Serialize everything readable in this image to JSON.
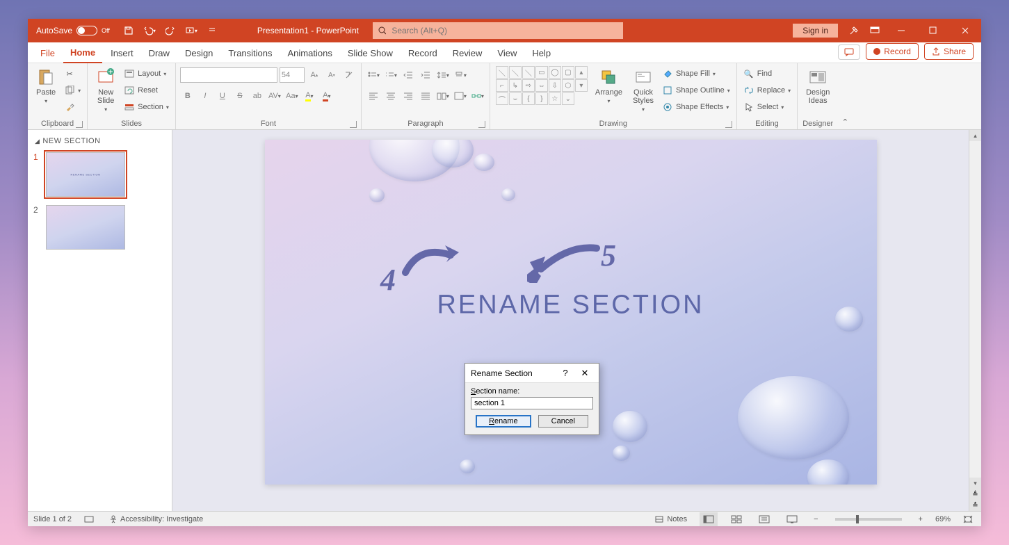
{
  "titlebar": {
    "autosave_label": "AutoSave",
    "autosave_state": "Off",
    "doc_title": "Presentation1 - PowerPoint",
    "search_placeholder": "Search (Alt+Q)",
    "signin": "Sign in"
  },
  "tabs": {
    "file": "File",
    "home": "Home",
    "insert": "Insert",
    "draw": "Draw",
    "design": "Design",
    "transitions": "Transitions",
    "animations": "Animations",
    "slideshow": "Slide Show",
    "record": "Record",
    "review": "Review",
    "view": "View",
    "help": "Help",
    "record_btn": "Record",
    "share_btn": "Share"
  },
  "ribbon": {
    "clipboard": {
      "paste": "Paste",
      "label": "Clipboard"
    },
    "slides": {
      "new_slide": "New\nSlide",
      "layout": "Layout",
      "reset": "Reset",
      "section": "Section",
      "label": "Slides"
    },
    "font": {
      "size": "54",
      "label": "Font"
    },
    "paragraph": {
      "label": "Paragraph"
    },
    "drawing": {
      "arrange": "Arrange",
      "quick_styles": "Quick\nStyles",
      "shape_fill": "Shape Fill",
      "shape_outline": "Shape Outline",
      "shape_effects": "Shape Effects",
      "label": "Drawing"
    },
    "editing": {
      "find": "Find",
      "replace": "Replace",
      "select": "Select",
      "label": "Editing"
    },
    "designer": {
      "design_ideas": "Design\nIdeas",
      "label": "Designer"
    }
  },
  "panel": {
    "section_header": "NEW SECTION",
    "slide1_num": "1",
    "slide2_num": "2",
    "thumb_text": "RENAME SECTION"
  },
  "slide": {
    "title": "RENAME SECTION"
  },
  "dialog": {
    "title": "Rename Section",
    "help": "?",
    "label_prefix": "S",
    "label_rest": "ection name:",
    "value": "section 1",
    "rename_u": "R",
    "rename_rest": "ename",
    "cancel": "Cancel"
  },
  "annotations": {
    "n4": "4",
    "n5": "5"
  },
  "status": {
    "slide_pos": "Slide 1 of 2",
    "accessibility": "Accessibility: Investigate",
    "notes": "Notes",
    "zoom": "69%"
  }
}
